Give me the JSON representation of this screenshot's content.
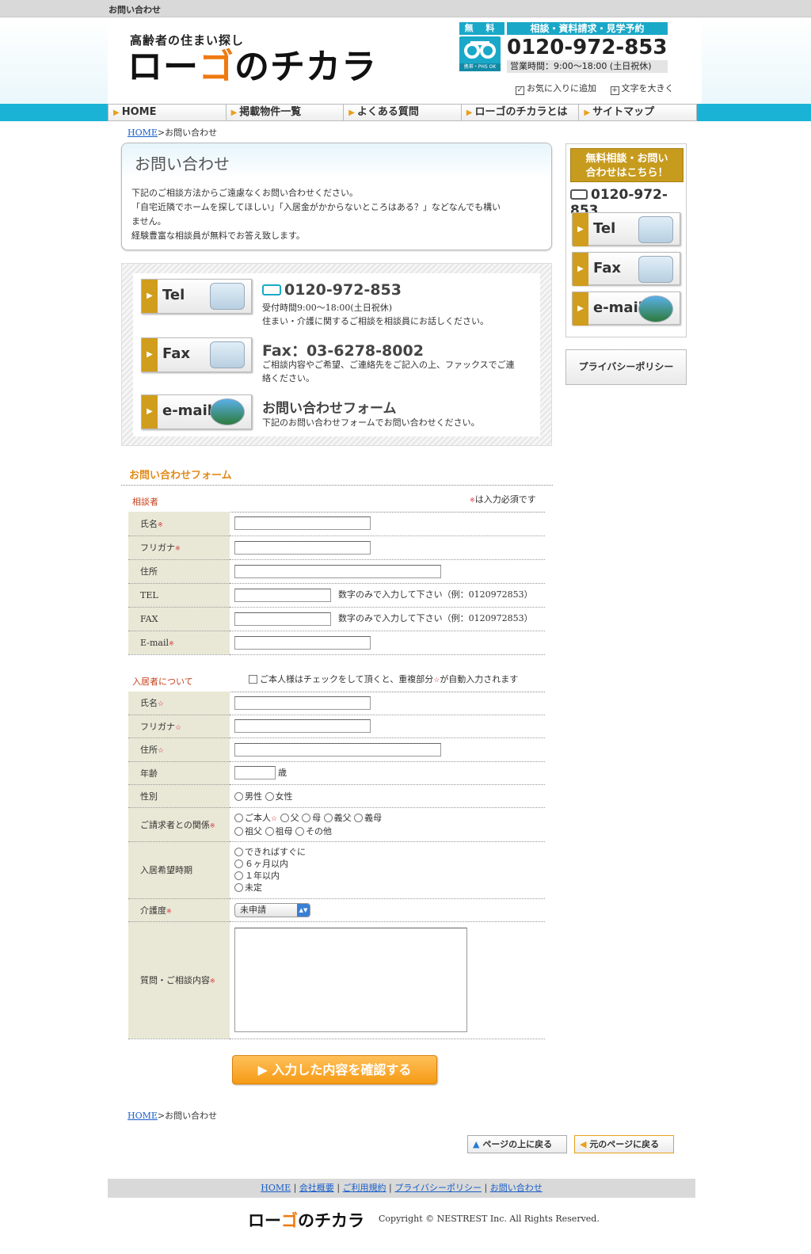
{
  "window_title": "お問い合わせ",
  "header": {
    "logo_tagline": "高齢者の住まい探し",
    "logo_name_a": "ロー",
    "logo_name_b": "ゴ",
    "logo_name_c": "のチカラ",
    "freedial_label": "無 料",
    "freedial_tag": "相談・資料請求・見学予約",
    "freedial_phs": "携帯・PHS OK",
    "freedial_number": "0120-972-853",
    "freedial_hours": "営業時間：9:00〜18:00 (土日祝休)",
    "favorite_label": "お気に入りに追加",
    "fontsize_label": "文字を大きく"
  },
  "nav": [
    "HOME",
    "掲載物件一覧",
    "よくある質問",
    "ローゴのチカラとは",
    "サイトマップ"
  ],
  "breadcrumb": {
    "home": "HOME",
    "sep": ">",
    "current": "お問い合わせ"
  },
  "intro": {
    "title": "お問い合わせ",
    "line1": "下記のご相談方法からご遠慮なくお問い合わせください。",
    "line2": "「自宅近隣でホームを探してほしい」「入居金がかからないところはある？」などなんでも構い",
    "line3": "ません。",
    "line4": "経験豊富な相談員が無料でお答え致します。"
  },
  "contact": {
    "tel_btn": "Tel",
    "fax_btn": "Fax",
    "email_btn": "e-mail",
    "tel_number": "0120-972-853",
    "tel_hours": "受付時間9:00〜18:00(土日祝休)",
    "tel_desc": "住まい・介護に関するご相談を相談員にお話しください。",
    "fax_title": "Fax：03-6278-8002",
    "fax_desc1": "ご相談内容やご希望、ご連絡先をご記入の上、ファックスでご連",
    "fax_desc2": "絡ください。",
    "form_title": "お問い合わせフォーム",
    "form_desc": "下記のお問い合わせフォームでお問い合わせください。"
  },
  "sidebar": {
    "head1": "無料相談・お問い",
    "head2": "合わせはこちら！",
    "number": "0120-972-853",
    "tel": "Tel",
    "fax": "Fax",
    "email": "e-mail",
    "privacy": "プライバシーポリシー"
  },
  "form": {
    "title": "お問い合わせフォーム",
    "consultant_section": "相談者",
    "required_mark": "※",
    "required_note": "は入力必須です",
    "fields1": {
      "name": "氏名",
      "kana": "フリガナ",
      "address": "住所",
      "tel": "TEL",
      "fax": "FAX",
      "email": "E-mail",
      "tel_hint": "数字のみで入力して下さい（例：0120972853）",
      "fax_hint": "数字のみで入力して下さい（例：0120972853）"
    },
    "resident_section": "入居者について",
    "self_check_a": "ご本人様はチェックをして頂くと、重複部分",
    "self_check_star": "☆",
    "self_check_b": "が自動入力されます",
    "fields2": {
      "name": "氏名",
      "kana": "フリガナ",
      "address": "住所",
      "age": "年齢",
      "age_unit": "歳",
      "gender": "性別",
      "male": "男性",
      "female": "女性",
      "relation": "ご請求者との関係",
      "rel_self": "ご本人",
      "rel_father": "父",
      "rel_mother": "母",
      "rel_fil": "義父",
      "rel_mil": "義母",
      "rel_gf": "祖父",
      "rel_gm": "祖母",
      "rel_other": "その他",
      "timing": "入居希望時期",
      "t1": "できればすぐに",
      "t2": "６ヶ月以内",
      "t3": "１年以内",
      "t4": "未定",
      "care": "介護度",
      "care_value": "未申請",
      "question": "質問・ご相談内容"
    },
    "submit": "入力した内容を確認する"
  },
  "page_nav": {
    "top": "ページの上に戻る",
    "back": "元のページに戻る"
  },
  "footer": {
    "links": [
      "HOME",
      "会社概要",
      "ご利用規約",
      "プライバシーポリシー",
      "お問い合わせ"
    ],
    "logo_a": "ロー",
    "logo_b": "ゴ",
    "logo_c": "のチカラ",
    "copyright": "Copyright © NESTREST Inc. All Rights Reserved."
  }
}
